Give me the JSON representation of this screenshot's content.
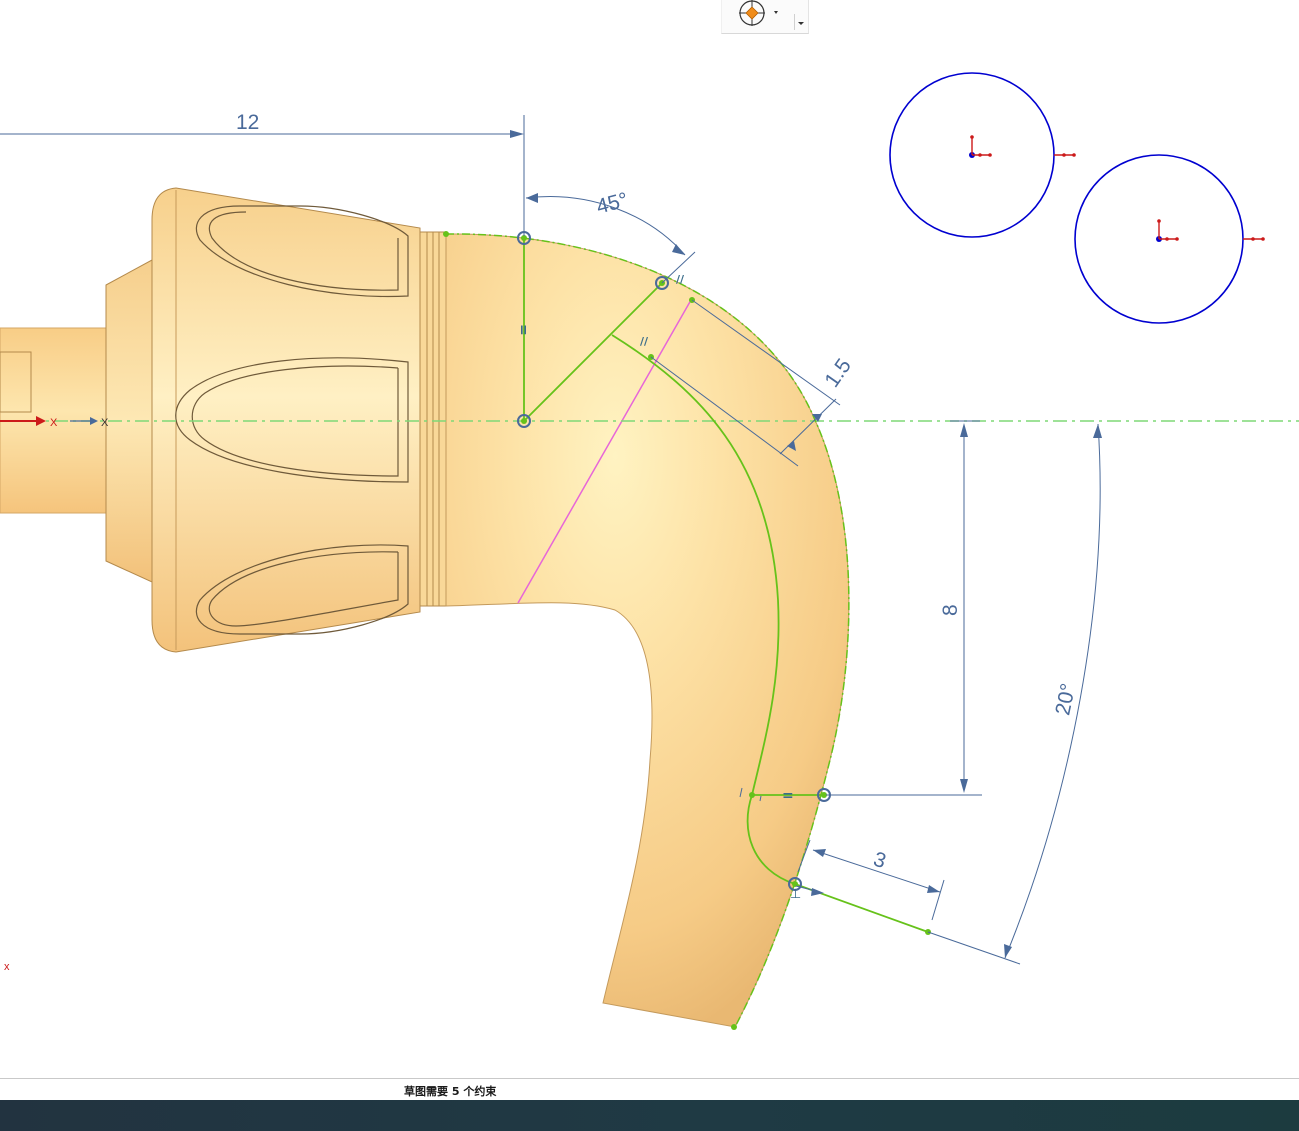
{
  "toolbar": {
    "snap_icon": "snap-point-icon",
    "dropdown_icon": "chevron-down-icon",
    "overflow_icon": "chevron-down-icon"
  },
  "dimensions": {
    "horizontal_length": "12",
    "arc_angle": "45°",
    "offset": "1.5",
    "vertical_length": "8",
    "bottom_angle": "20°",
    "end_length": "3"
  },
  "constraint_symbols": {
    "equal": "=",
    "parallel_1": "//",
    "parallel_2": "//",
    "perpendicular": "⊥"
  },
  "axis_markers": {
    "left_x": "X",
    "origin_x": "X",
    "bottom_x": "x"
  },
  "status": {
    "message": "草图需要 5 个约束"
  },
  "colors": {
    "part_surface": "#fcd48f",
    "sketch_curve": "#66c21a",
    "dimension": "#4a6a9a",
    "reference_axis": "#7fd877",
    "section_line": "#e766d8",
    "datum_circle": "#0000d0",
    "csys_red": "#cc1a1a",
    "taskbar": "#223340"
  }
}
